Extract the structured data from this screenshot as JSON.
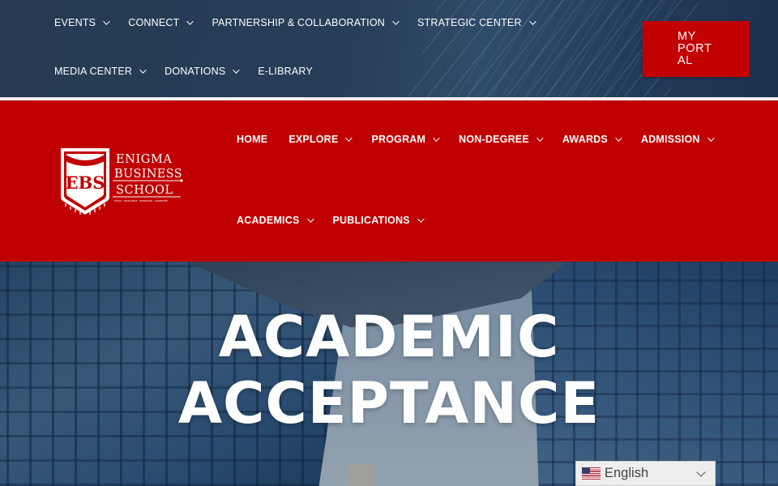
{
  "top_nav": {
    "row1": [
      {
        "label": "EVENTS",
        "dropdown": true
      },
      {
        "label": "CONNECT",
        "dropdown": true
      },
      {
        "label": "PARTNERSHIP & COLLABORATION",
        "dropdown": true
      },
      {
        "label": "STRATEGIC CENTER",
        "dropdown": true
      }
    ],
    "row2": [
      {
        "label": "MEDIA CENTER",
        "dropdown": true
      },
      {
        "label": "DONATIONS",
        "dropdown": true
      },
      {
        "label": "E-LIBRARY",
        "dropdown": false
      }
    ]
  },
  "portal_button": {
    "lines": [
      "MY",
      "PORT",
      "AL"
    ]
  },
  "logo": {
    "monogram": "EBS",
    "name_line1": "ENIGMA",
    "name_line2": "BUSINESS",
    "name_line3": "SCHOOL",
    "tagline": "ETHICS · EXCELLENCE · EXPERIENCE · LEADERSHIP"
  },
  "main_nav": {
    "row1": [
      {
        "label": "HOME",
        "dropdown": false
      },
      {
        "label": "EXPLORE",
        "dropdown": true
      },
      {
        "label": "PROGRAM",
        "dropdown": true
      },
      {
        "label": "NON-DEGREE",
        "dropdown": true
      },
      {
        "label": "AWARDS",
        "dropdown": true
      },
      {
        "label": "ADMISSION",
        "dropdown": true
      }
    ],
    "row2": [
      {
        "label": "ACADEMICS",
        "dropdown": true
      },
      {
        "label": "PUBLICATIONS",
        "dropdown": true
      }
    ]
  },
  "hero": {
    "title": "ACADEMIC ACCEPTANCE"
  },
  "language": {
    "label": "English",
    "flag_icon": "us-flag-icon"
  },
  "colors": {
    "brand_red": "#c00000",
    "portal_red": "#c20000",
    "text_white": "#ffffff"
  }
}
